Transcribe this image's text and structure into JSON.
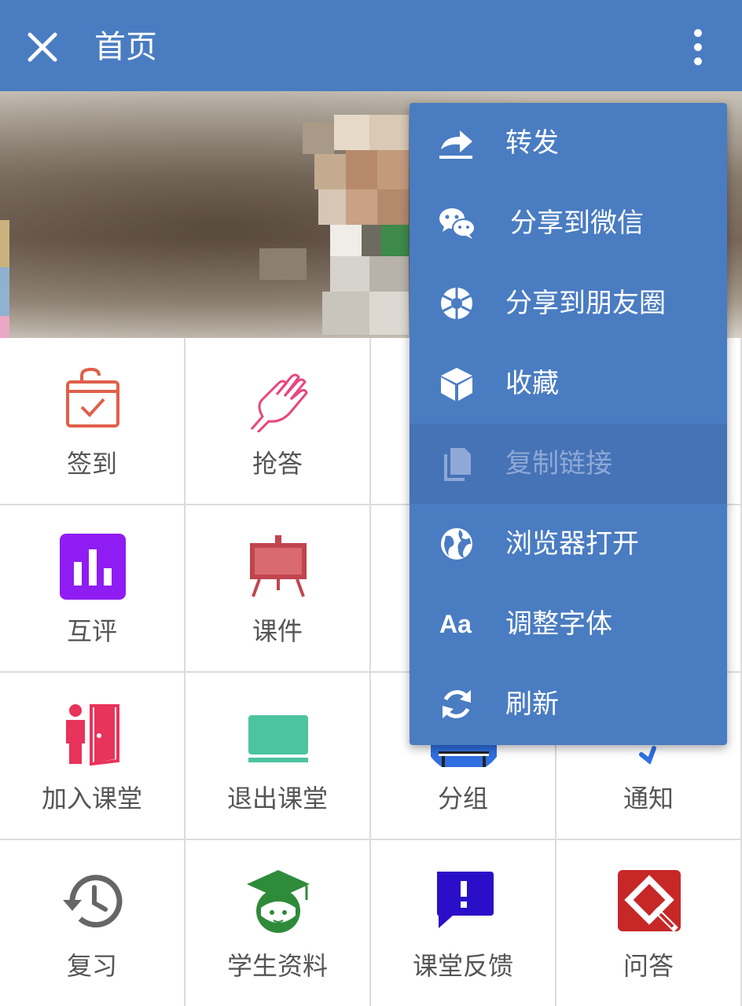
{
  "header": {
    "title": "首页",
    "close_icon": "close-icon",
    "more_icon": "more-vertical-icon",
    "bg_color": "#4a7cc2"
  },
  "grid": {
    "rows": [
      [
        {
          "label": "签到",
          "icon": "check-in-calendar-icon"
        },
        {
          "label": "抢答",
          "icon": "raise-hand-icon"
        },
        {
          "label": "",
          "icon": ""
        },
        {
          "label": "",
          "icon": ""
        }
      ],
      [
        {
          "label": "互评",
          "icon": "bar-chart-icon"
        },
        {
          "label": "课件",
          "icon": "easel-board-icon"
        },
        {
          "label": "",
          "icon": ""
        },
        {
          "label": "",
          "icon": ""
        }
      ],
      [
        {
          "label": "加入课堂",
          "icon": "person-door-icon"
        },
        {
          "label": "退出课堂",
          "icon": "laptop-icon"
        },
        {
          "label": "分组",
          "icon": "group-table-icon"
        },
        {
          "label": "通知",
          "icon": "megaphone-icon"
        }
      ],
      [
        {
          "label": "复习",
          "icon": "history-clock-icon"
        },
        {
          "label": "学生资料",
          "icon": "graduate-student-icon"
        },
        {
          "label": "课堂反馈",
          "icon": "feedback-bubble-icon"
        },
        {
          "label": "问答",
          "icon": "qa-icon"
        }
      ]
    ]
  },
  "menu": {
    "items": [
      {
        "label": "转发",
        "icon": "forward-icon",
        "enabled": true
      },
      {
        "label": "分享到微信",
        "icon": "wechat-icon",
        "enabled": true
      },
      {
        "label": "分享到朋友圈",
        "icon": "moments-icon",
        "enabled": true
      },
      {
        "label": "收藏",
        "icon": "cube-icon",
        "enabled": true
      },
      {
        "label": "复制链接",
        "icon": "copy-icon",
        "enabled": false
      },
      {
        "label": "浏览器打开",
        "icon": "globe-icon",
        "enabled": true
      },
      {
        "label": "调整字体",
        "icon": "font-size-icon",
        "icon_text": "Aa",
        "enabled": true
      },
      {
        "label": "刷新",
        "icon": "refresh-icon",
        "enabled": true
      }
    ]
  }
}
